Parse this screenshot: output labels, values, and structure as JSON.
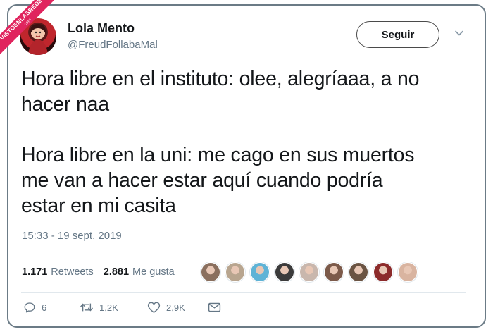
{
  "watermark": {
    "text": "VISTOENLASREDES",
    "suffix": ".com"
  },
  "author": {
    "name": "Lola Mento",
    "handle": "@FreudFollabaMal"
  },
  "follow_button": {
    "label": "Seguir"
  },
  "tweet": {
    "text": "Hora libre en el instituto: olee, alegríaaa, a no\nhacer naa\n\nHora libre en la uni: me cago en sus muertos\nme van a hacer estar aquí cuando podría\nestar en mi casita",
    "timestamp": "15:33 - 19 sept. 2019"
  },
  "stats": {
    "retweets_count": "1.171",
    "retweets_label": "Retweets",
    "likes_count": "2.881",
    "likes_label": "Me gusta"
  },
  "liker_avatars": [
    {
      "color": "#8a6f5e"
    },
    {
      "color": "#b8a58f"
    },
    {
      "color": "#5fb3d6"
    },
    {
      "color": "#3b3b3b"
    },
    {
      "color": "#c9b7ad"
    },
    {
      "color": "#7c5a4a"
    },
    {
      "color": "#6b5443"
    },
    {
      "color": "#8c2b2b"
    },
    {
      "color": "#d9b4a0"
    }
  ],
  "actions": {
    "replies": "6",
    "retweets": "1,2K",
    "likes": "2,9K"
  },
  "colors": {
    "text": "#14171a",
    "secondary": "#657786",
    "divider": "#e1e8ed",
    "watermark": "#e0245e"
  }
}
